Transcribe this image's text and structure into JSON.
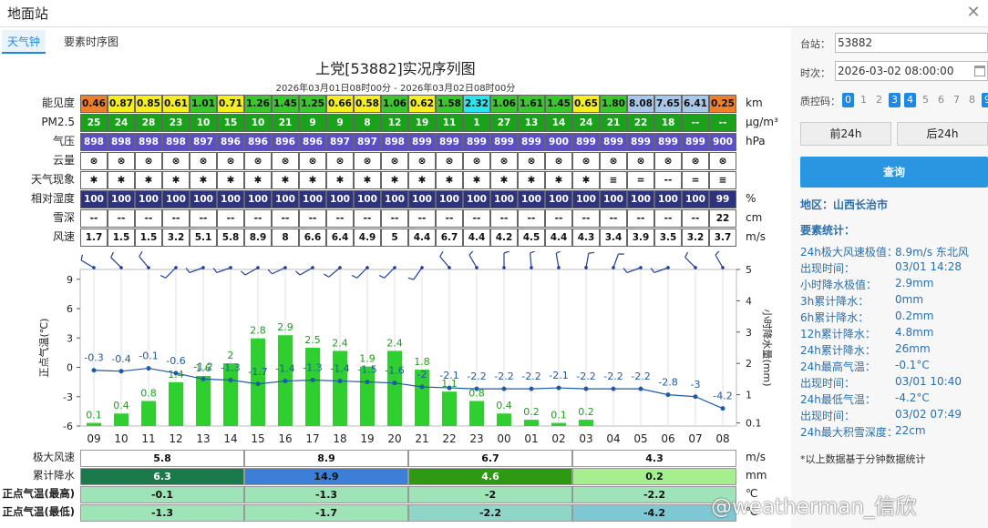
{
  "window": {
    "title": "地面站",
    "close_icon": "close-icon"
  },
  "tabs": [
    "天气钟",
    "要素时序图"
  ],
  "chart": {
    "title": "上党[53882]实况序列图",
    "subtitle": "2026年03月01日08时00分 - 2026年03月02日08时00分"
  },
  "grid_rows": [
    {
      "label": "能见度",
      "unit": "km",
      "values": [
        "0.46",
        "0.87",
        "0.85",
        "0.61",
        "1.01",
        "0.71",
        "1.26",
        "1.45",
        "1.25",
        "0.66",
        "0.58",
        "1.06",
        "0.62",
        "1.58",
        "2.32",
        "1.06",
        "1.61",
        "1.45",
        "0.65",
        "1.80",
        "8.08",
        "7.65",
        "6.41",
        "0.25"
      ],
      "colors": [
        "#f07f2a",
        "#f7ee1e",
        "#f7ee1e",
        "#f7ee1e",
        "#39c72b",
        "#f7ee1e",
        "#39c72b",
        "#39c72b",
        "#39c72b",
        "#f7ee1e",
        "#f7ee1e",
        "#39c72b",
        "#f7ee1e",
        "#39c72b",
        "#27e6f0",
        "#39c72b",
        "#39c72b",
        "#39c72b",
        "#f7ee1e",
        "#39c72b",
        "#a8c8ea",
        "#a8c8ea",
        "#a8c8ea",
        "#f07f2a"
      ]
    },
    {
      "label": "PM2.5",
      "unit": "μg/m³",
      "values": [
        "25",
        "24",
        "28",
        "23",
        "10",
        "15",
        "10",
        "21",
        "9",
        "9",
        "8",
        "12",
        "19",
        "11",
        "1",
        "27",
        "13",
        "14",
        "24",
        "21",
        "22",
        "18",
        "--",
        "--"
      ],
      "color": "#1aa31a"
    },
    {
      "label": "气压",
      "unit": "hPa",
      "values": [
        "898",
        "898",
        "898",
        "898",
        "897",
        "896",
        "896",
        "896",
        "896",
        "897",
        "897",
        "898",
        "899",
        "899",
        "899",
        "899",
        "899",
        "900",
        "899",
        "899",
        "899",
        "899",
        "899",
        "900"
      ],
      "color": "#5b4fc7"
    },
    {
      "label": "云量",
      "unit": "",
      "values": [
        "⊗",
        "⊗",
        "⊗",
        "⊗",
        "⊗",
        "⊗",
        "⊗",
        "⊗",
        "⊗",
        "⊗",
        "⊗",
        "⊗",
        "⊗",
        "⊗",
        "⊗",
        "⊗",
        "⊗",
        "⊗",
        "⊗",
        "⊗",
        "⊗",
        "⊗",
        "⊗",
        "⊗"
      ],
      "color": "#ffffff"
    },
    {
      "label": "天气现象",
      "unit": "",
      "values": [
        "✱",
        "✱",
        "✱",
        "✱",
        "✱",
        "✱",
        "✱",
        "✱",
        "✱",
        "✱",
        "✱",
        "✱",
        "✱",
        "✱",
        "✱",
        "✱",
        "✱",
        "✱",
        "✱",
        "≡",
        "=",
        "--",
        "=",
        "≡"
      ],
      "color": "#ffffff"
    },
    {
      "label": "相对湿度",
      "unit": "%",
      "values": [
        "100",
        "100",
        "100",
        "100",
        "100",
        "100",
        "100",
        "100",
        "100",
        "100",
        "100",
        "100",
        "100",
        "100",
        "100",
        "100",
        "100",
        "100",
        "100",
        "100",
        "100",
        "100",
        "100",
        "99"
      ],
      "color": "#2e3380"
    },
    {
      "label": "雪深",
      "unit": "cm",
      "values": [
        "--",
        "--",
        "--",
        "--",
        "--",
        "--",
        "--",
        "--",
        "--",
        "--",
        "--",
        "--",
        "--",
        "--",
        "--",
        "--",
        "--",
        "--",
        "--",
        "--",
        "--",
        "--",
        "--",
        "22"
      ],
      "color": "#ffffff"
    },
    {
      "label": "风速",
      "unit": "m/s",
      "values": [
        "1.7",
        "1.5",
        "1.5",
        "3.2",
        "5.1",
        "5.8",
        "8.9",
        "8",
        "6.6",
        "6.4",
        "4.9",
        "5",
        "4.4",
        "6.7",
        "4.4",
        "4.2",
        "4.5",
        "4.4",
        "4.3",
        "3.4",
        "3.9",
        "3.5",
        "3.2",
        "3.7"
      ],
      "color": "#ffffff"
    }
  ],
  "chart_data": {
    "type": "bar",
    "categories": [
      "09",
      "10",
      "11",
      "12",
      "13",
      "14",
      "15",
      "16",
      "17",
      "18",
      "19",
      "20",
      "21",
      "22",
      "23",
      "00",
      "01",
      "02",
      "03",
      "04",
      "05",
      "06",
      "07",
      "08"
    ],
    "series": [
      {
        "name": "小时降水量(mm)",
        "type": "bar",
        "values": [
          0.1,
          0.4,
          0.8,
          1.4,
          1.6,
          2,
          2.8,
          2.9,
          2.5,
          2.4,
          1.9,
          2.4,
          1.8,
          1.1,
          0.8,
          0.4,
          0.2,
          0.1,
          0.2,
          0,
          0,
          0,
          0,
          0
        ]
      },
      {
        "name": "正点气温(℃)",
        "type": "line",
        "values": [
          -0.3,
          -0.4,
          -0.1,
          -0.6,
          -1.2,
          -1.3,
          -1.7,
          -1.4,
          -1.3,
          -1.4,
          -1.5,
          -1.6,
          -2,
          -2.1,
          -2.2,
          -2.2,
          -2.2,
          -2.1,
          -2.2,
          -2.2,
          -2.2,
          -2.8,
          -3,
          -4.2
        ]
      }
    ],
    "bar_labels": [
      "0.1",
      "0.4",
      "0.8",
      "1.4",
      "1.6",
      "2",
      "2.8",
      "2.9",
      "2.5",
      "2.4",
      "1.9",
      "2.4",
      "1.8",
      "1.1",
      "0.8",
      "0.4",
      "0.2",
      "0.1",
      "0.2",
      "",
      "",
      "",
      "",
      ""
    ],
    "line_labels": [
      "-0.3",
      "-0.4",
      "-0.1",
      "-0.6",
      "-1.2",
      "-1.3",
      "-1.7",
      "-1.4",
      "-1.3",
      "-1.4",
      "-1.5",
      "-1.6",
      "-2",
      "-2.1",
      "-2.2",
      "-2.2",
      "-2.2",
      "-2.1",
      "-2.2",
      "-2.2",
      "-2.2",
      "-2.8",
      "-3",
      "-4.2"
    ],
    "ylabel_left": "正点气温(℃)",
    "ylabel_right": "小时降水量(mm)",
    "left_ticks": [
      "9",
      "6",
      "3",
      "0",
      "-3",
      "-6"
    ],
    "left_range": [
      -6,
      10
    ],
    "right_ticks": [
      "5",
      "4",
      "3",
      "2",
      "1",
      "0.1"
    ],
    "wind_dirs": [
      300,
      315,
      320,
      225,
      250,
      250,
      240,
      245,
      240,
      230,
      225,
      225,
      215,
      320,
      330,
      0,
      355,
      350,
      10,
      20,
      250,
      250,
      315,
      330
    ],
    "bar_color": "#2fcf2f",
    "line_color": "#1e5aa8"
  },
  "bottom_rows": [
    {
      "label": "极大风速",
      "unit": "m/s",
      "values": [
        "5.8",
        "8.9",
        "6.7",
        "4.3"
      ],
      "colors": [
        "#ffffff",
        "#ffffff",
        "#ffffff",
        "#ffffff"
      ]
    },
    {
      "label": "累计降水",
      "unit": "mm",
      "values": [
        "6.3",
        "14.9",
        "4.6",
        "0.2"
      ],
      "colors": [
        "#1a7a4a",
        "#3b7fd6",
        "#2e9a12",
        "#a6ef8f"
      ]
    },
    {
      "label": "正点气温(最高)",
      "unit": "℃",
      "values": [
        "-0.1",
        "-1.3",
        "-2",
        "-2.2"
      ],
      "colors": [
        "#9fe3b8",
        "#9fe3b8",
        "#9fe3b8",
        "#9fe3b8"
      ]
    },
    {
      "label": "正点气温(最低)",
      "unit": "℃",
      "values": [
        "-1.3",
        "-1.7",
        "-2.2",
        "-4.2"
      ],
      "colors": [
        "#9fe3b8",
        "#9fe3b8",
        "#8fd6c8",
        "#7dc8d2"
      ]
    }
  ],
  "panel": {
    "station_label": "台站：",
    "station_value": "53882",
    "time_label": "时次：",
    "time_value": "2026-03-02 08:00:00",
    "qc_label": "质控码：",
    "qc_codes": [
      "0",
      "1",
      "2",
      "3",
      "4",
      "5",
      "6",
      "7",
      "8",
      "9"
    ],
    "qc_active": [
      "0",
      "3",
      "4",
      "9"
    ],
    "prev_label": "前24h",
    "next_label": "后24h",
    "query_label": "查询",
    "region": "地区：山西长治市",
    "stats_title": "要素统计：",
    "stats": [
      {
        "k": "24h极大风速极值：",
        "v": "8.9m/s 东北风"
      },
      {
        "k": "出现时间：",
        "v": "03/01 14:28"
      },
      {
        "k": "小时降水极值：",
        "v": "2.9mm"
      },
      {
        "k": "3h累计降水：",
        "v": "0mm"
      },
      {
        "k": "6h累计降水：",
        "v": "0.2mm"
      },
      {
        "k": "12h累计降水：",
        "v": "4.8mm"
      },
      {
        "k": "24h累计降水：",
        "v": "26mm"
      },
      {
        "k": "24h最高气温：",
        "v": "-0.1°C"
      },
      {
        "k": "出现时间：",
        "v": "03/01 10:40"
      },
      {
        "k": "24h最低气温：",
        "v": "-4.2°C"
      },
      {
        "k": "出现时间：",
        "v": "03/02 07:49"
      },
      {
        "k": "24h最大积雪深度：",
        "v": "22cm"
      }
    ],
    "note": "*以上数据基于分钟数据统计"
  },
  "watermark": "@weatherman_信欣"
}
